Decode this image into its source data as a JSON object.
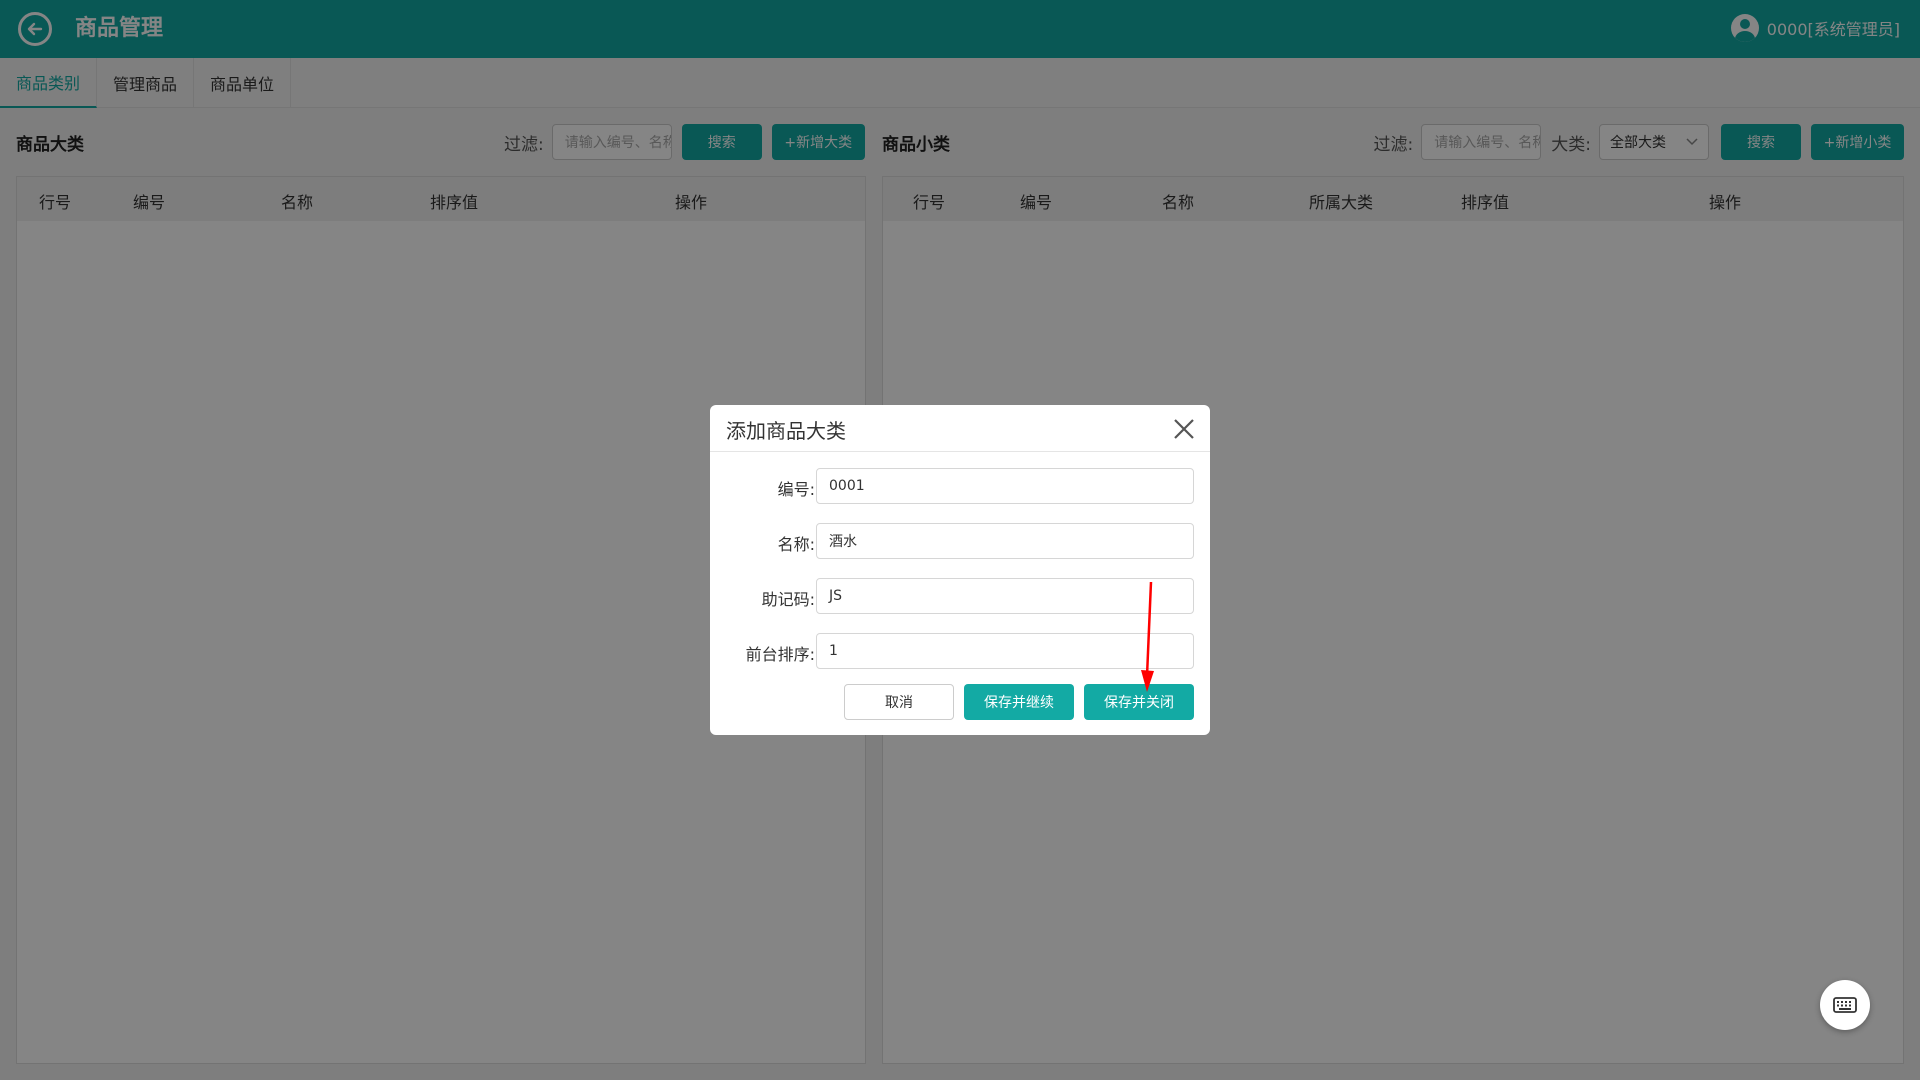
{
  "header": {
    "title": "商品管理",
    "user": "0000[系统管理员]"
  },
  "tabs": [
    {
      "label": "商品类别",
      "active": true
    },
    {
      "label": "管理商品",
      "active": false
    },
    {
      "label": "商品单位",
      "active": false
    }
  ],
  "left_panel": {
    "title": "商品大类",
    "filter_label": "过滤:",
    "filter_placeholder": "请输入编号、名称",
    "search_label": "搜索",
    "add_label": "+新增大类",
    "columns": [
      "行号",
      "编号",
      "名称",
      "排序值",
      "操作"
    ]
  },
  "right_panel": {
    "title": "商品小类",
    "filter_label": "过滤:",
    "filter_placeholder": "请输入编号、名称",
    "category_label": "大类:",
    "category_selected": "全部大类",
    "search_label": "搜索",
    "add_label": "+新增小类",
    "columns": [
      "行号",
      "编号",
      "名称",
      "所属大类",
      "排序值",
      "操作"
    ]
  },
  "modal": {
    "title": "添加商品大类",
    "fields": [
      {
        "label": "编号:",
        "value": "0001"
      },
      {
        "label": "名称:",
        "value": "酒水"
      },
      {
        "label": "助记码:",
        "value": "JS"
      },
      {
        "label": "前台排序:",
        "value": "1"
      }
    ],
    "cancel_label": "取消",
    "save_continue_label": "保存并继续",
    "save_close_label": "保存并关闭"
  },
  "colors": {
    "accent": "#13aaa4",
    "annotation_arrow": "#ff0000"
  },
  "icons": {
    "back": "back-arrow-icon",
    "user": "user-avatar-icon",
    "close": "close-icon",
    "keyboard": "keyboard-icon",
    "dropdown": "chevron-down-icon"
  }
}
